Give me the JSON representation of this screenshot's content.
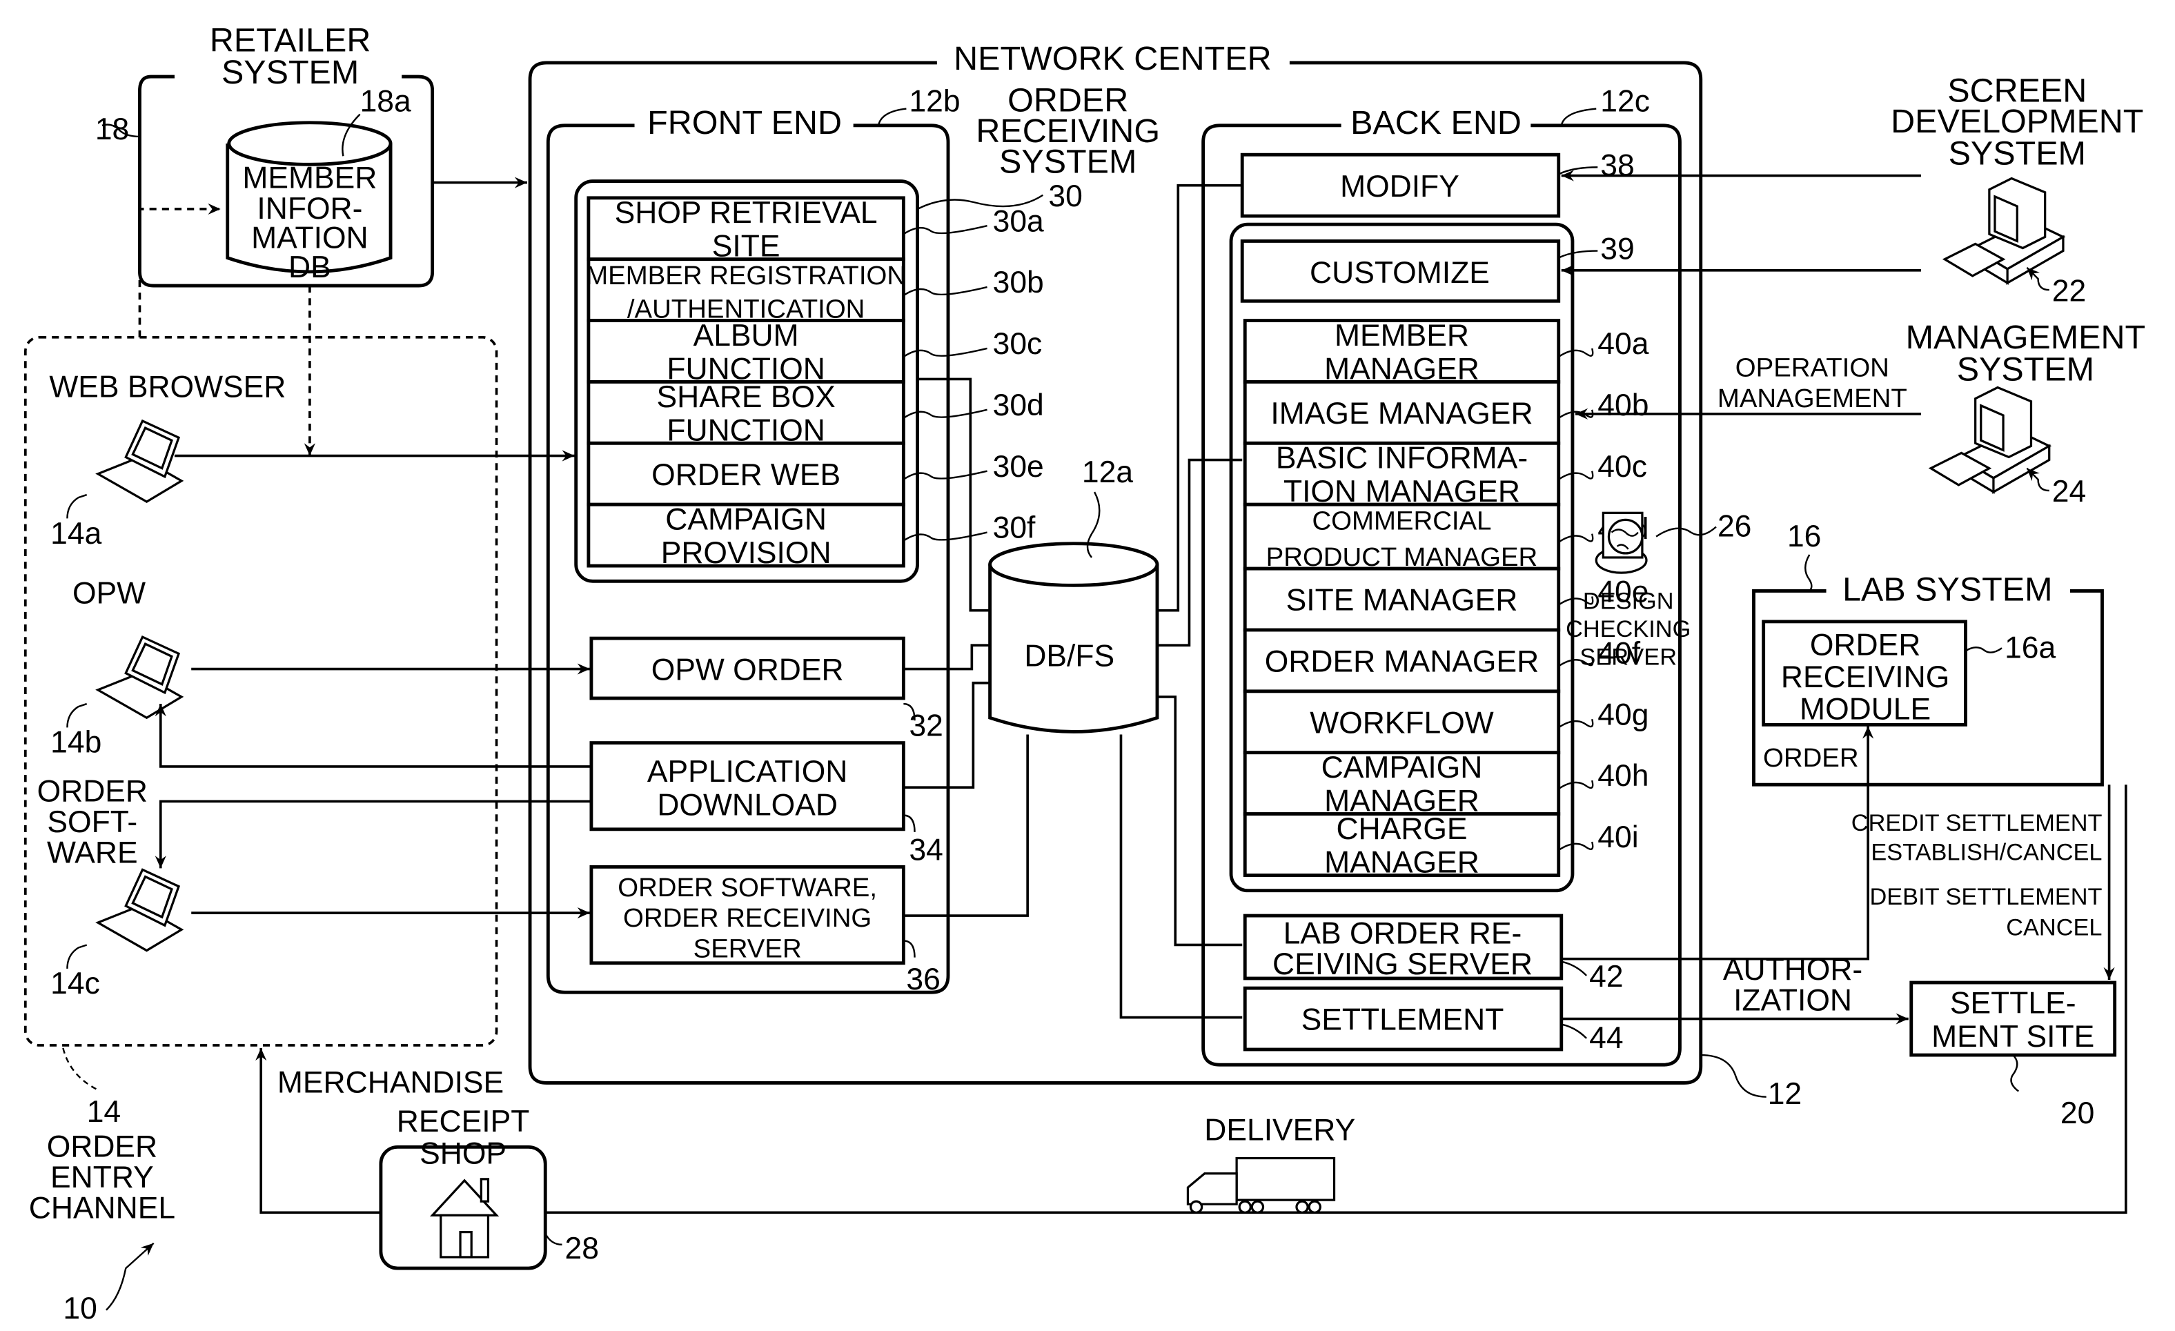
{
  "figure": {
    "system_ref": "10",
    "retailer": {
      "title_lines": [
        "RETAILER",
        "SYSTEM"
      ],
      "ref": "18",
      "db_ref": "18a",
      "db_label_lines": [
        "MEMBER",
        "INFOR-",
        "MATION",
        "DB"
      ]
    },
    "order_entry": {
      "ref": "14",
      "label_lines": [
        "ORDER",
        "ENTRY",
        "CHANNEL"
      ],
      "web_browser": {
        "label": "WEB BROWSER",
        "ref": "14a"
      },
      "opw": {
        "label": "OPW",
        "ref": "14b"
      },
      "order_software": {
        "label_lines": [
          "ORDER",
          "SOFT-",
          "WARE"
        ],
        "ref": "14c"
      }
    },
    "network_center": {
      "title": "NETWORK CENTER",
      "ref": "12",
      "db": {
        "label": "DB/FS",
        "ref": "12a"
      },
      "front_end": {
        "title": "FRONT END",
        "ref": "12b",
        "order_receiving_system": {
          "label_lines": [
            "ORDER",
            "RECEIVING",
            "SYSTEM"
          ],
          "ref": "30",
          "modules": [
            {
              "lines": [
                "SHOP RETRIEVAL",
                "SITE"
              ],
              "ref": "30a"
            },
            {
              "lines": [
                "MEMBER REGISTRATION",
                "/AUTHENTICATION"
              ],
              "ref": "30b"
            },
            {
              "lines": [
                "ALBUM",
                "FUNCTION"
              ],
              "ref": "30c"
            },
            {
              "lines": [
                "SHARE BOX",
                "FUNCTION"
              ],
              "ref": "30d"
            },
            {
              "lines": [
                "ORDER WEB"
              ],
              "ref": "30e"
            },
            {
              "lines": [
                "CAMPAIGN",
                "PROVISION"
              ],
              "ref": "30f"
            }
          ]
        },
        "opw_order": {
          "label": "OPW ORDER",
          "ref": "32"
        },
        "application_download": {
          "lines": [
            "APPLICATION",
            "DOWNLOAD"
          ],
          "ref": "34"
        },
        "order_software_server": {
          "lines": [
            "ORDER SOFTWARE,",
            "ORDER RECEIVING",
            "SERVER"
          ],
          "ref": "36"
        }
      },
      "back_end": {
        "title": "BACK END",
        "ref": "12c",
        "modify": {
          "label": "MODIFY",
          "ref": "38"
        },
        "customize": {
          "label": "CUSTOMIZE",
          "ref": "39"
        },
        "managers": [
          {
            "lines": [
              "MEMBER",
              "MANAGER"
            ],
            "ref": "40a"
          },
          {
            "lines": [
              "IMAGE MANAGER"
            ],
            "ref": "40b"
          },
          {
            "lines": [
              "BASIC INFORMA-",
              "TION MANAGER"
            ],
            "ref": "40c"
          },
          {
            "lines": [
              "COMMERCIAL",
              "PRODUCT MANAGER"
            ],
            "ref": "40d"
          },
          {
            "lines": [
              "SITE MANAGER"
            ],
            "ref": "40e"
          },
          {
            "lines": [
              "ORDER MANAGER"
            ],
            "ref": "40f"
          },
          {
            "lines": [
              "WORKFLOW"
            ],
            "ref": "40g"
          },
          {
            "lines": [
              "CAMPAIGN",
              "MANAGER"
            ],
            "ref": "40h"
          },
          {
            "lines": [
              "CHARGE",
              "MANAGER"
            ],
            "ref": "40i"
          }
        ],
        "design_checking_server": {
          "lines": [
            "DESIGN",
            "CHECKING",
            "SERVER"
          ],
          "ref": "26"
        },
        "lab_order_server": {
          "lines": [
            "LAB ORDER RE-",
            "CEIVING SERVER"
          ],
          "ref": "42"
        },
        "settlement": {
          "label": "SETTLEMENT",
          "ref": "44"
        }
      }
    },
    "screen_development": {
      "lines": [
        "SCREEN",
        "DEVELOPMENT",
        "SYSTEM"
      ],
      "ref": "22"
    },
    "management_system": {
      "lines": [
        "MANAGEMENT",
        "SYSTEM"
      ],
      "ref": "24"
    },
    "operation_management": {
      "lines": [
        "OPERATION",
        "MANAGEMENT"
      ]
    },
    "lab_system": {
      "title": "LAB SYSTEM",
      "ref": "16",
      "module": {
        "lines": [
          "ORDER",
          "RECEIVING",
          "MODULE"
        ],
        "ref": "16a"
      },
      "order_label": "ORDER"
    },
    "settlement_site": {
      "lines": [
        "SETTLE-",
        "MENT SITE"
      ],
      "ref": "20"
    },
    "credit_label": [
      "CREDIT SETTLEMENT",
      "ESTABLISH/CANCEL"
    ],
    "debit_label": [
      "DEBIT SETTLEMENT",
      "CANCEL"
    ],
    "authorization_label": [
      "AUTHOR-",
      "IZATION"
    ],
    "receipt_shop": {
      "lines": [
        "RECEIPT",
        "SHOP"
      ],
      "ref": "28"
    },
    "merchandise_label": "MERCHANDISE",
    "delivery_label": "DELIVERY"
  }
}
